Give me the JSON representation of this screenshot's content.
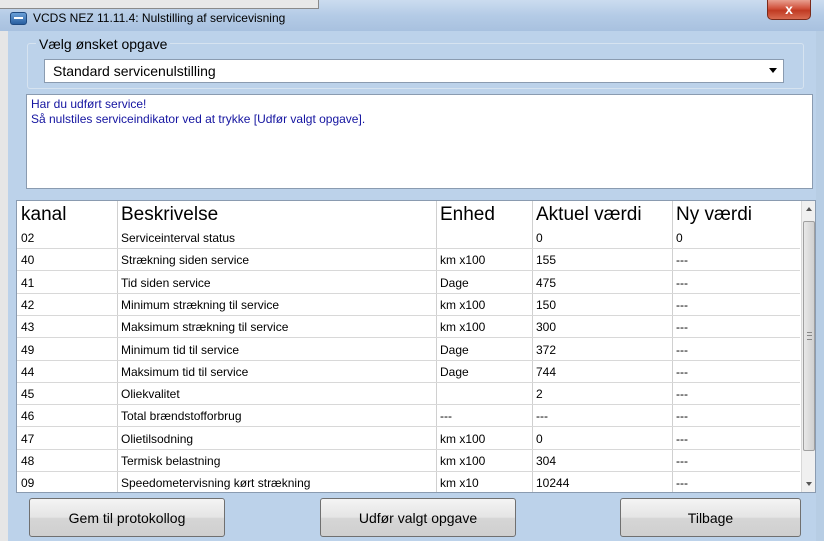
{
  "window": {
    "title": "VCDS NEZ 11.11.4:  Nulstilling af servicevisning",
    "close_label": "x"
  },
  "task": {
    "group_label": "Vælg ønsket opgave",
    "selected": "Standard servicenulstilling"
  },
  "message": {
    "line1": "Har du udført service!",
    "line2": "Så nulstiles serviceindikator ved at trykke [Udfør valgt opgave]."
  },
  "table": {
    "headers": [
      "kanal",
      "Beskrivelse",
      "Enhed",
      "Aktuel værdi",
      "Ny værdi"
    ],
    "rows": [
      [
        "02",
        "Serviceinterval status",
        "",
        "0",
        "0"
      ],
      [
        "40",
        "Strækning siden service",
        "km x100",
        "155",
        "---"
      ],
      [
        "41",
        "Tid siden service",
        "Dage",
        "475",
        "---"
      ],
      [
        "42",
        "Minimum strækning til service",
        "km x100",
        "150",
        "---"
      ],
      [
        "43",
        "Maksimum strækning til service",
        "km x100",
        "300",
        "---"
      ],
      [
        "49",
        "Minimum tid til service",
        "Dage",
        "372",
        "---"
      ],
      [
        "44",
        "Maksimum tid til service",
        "Dage",
        "744",
        "---"
      ],
      [
        "45",
        "Oliekvalitet",
        "",
        "2",
        "---"
      ],
      [
        "46",
        "Total brændstofforbrug",
        "---",
        "---",
        "---"
      ],
      [
        "47",
        "Olietilsodning",
        "km x100",
        "0",
        "---"
      ],
      [
        "48",
        "Termisk belastning",
        "km x100",
        "304",
        "---"
      ],
      [
        "09",
        "Speedometervisning kørt strækning",
        "km x10",
        "10244",
        "---"
      ]
    ]
  },
  "buttons": {
    "save_log": "Gem til protokollog",
    "execute": "Udfør valgt opgave",
    "back": "Tilbage"
  },
  "colors": {
    "message_text": "#1414a0",
    "window_frame": "#bcd2ea"
  }
}
